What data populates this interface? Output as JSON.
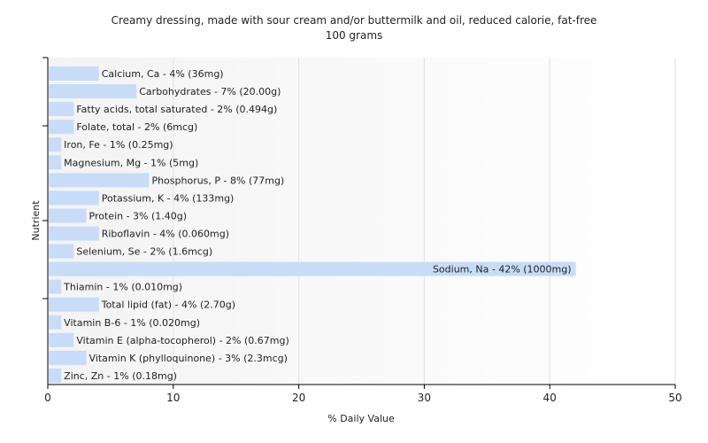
{
  "chart_data": {
    "type": "bar",
    "orientation": "horizontal",
    "title": "Creamy dressing, made with sour cream and/or buttermilk and oil, reduced calorie, fat-free",
    "subtitle": "100 grams",
    "xlabel": "% Daily Value",
    "ylabel": "Nutrient",
    "xlim": [
      0,
      50
    ],
    "xticks": [
      "0",
      "10",
      "20",
      "30",
      "40",
      "50"
    ],
    "grid": true,
    "bar_color": "#c8dcf7",
    "categories": [
      "Calcium, Ca",
      "Carbohydrates",
      "Fatty acids, total saturated",
      "Folate, total",
      "Iron, Fe",
      "Magnesium, Mg",
      "Phosphorus, P",
      "Potassium, K",
      "Protein",
      "Riboflavin",
      "Selenium, Se",
      "Sodium, Na",
      "Thiamin",
      "Total lipid (fat)",
      "Vitamin B-6",
      "Vitamin E (alpha-tocopherol)",
      "Vitamin K (phylloquinone)",
      "Zinc, Zn"
    ],
    "values": [
      4,
      7,
      2,
      2,
      1,
      1,
      8,
      4,
      3,
      4,
      2,
      42,
      1,
      4,
      1,
      2,
      3,
      1
    ],
    "labels": [
      "Calcium, Ca - 4% (36mg)",
      "Carbohydrates - 7% (20.00g)",
      "Fatty acids, total saturated - 2% (0.494g)",
      "Folate, total - 2% (6mcg)",
      "Iron, Fe - 1% (0.25mg)",
      "Magnesium, Mg - 1% (5mg)",
      "Phosphorus, P - 8% (77mg)",
      "Potassium, K - 4% (133mg)",
      "Protein - 3% (1.40g)",
      "Riboflavin - 4% (0.060mg)",
      "Selenium, Se - 2% (1.6mcg)",
      "Sodium, Na - 42% (1000mg)",
      "Thiamin - 1% (0.010mg)",
      "Total lipid (fat) - 4% (2.70g)",
      "Vitamin B-6 - 1% (0.020mg)",
      "Vitamin E (alpha-tocopherol) - 2% (0.67mg)",
      "Vitamin K (phylloquinone) - 3% (2.3mcg)",
      "Zinc, Zn - 1% (0.18mg)"
    ]
  }
}
